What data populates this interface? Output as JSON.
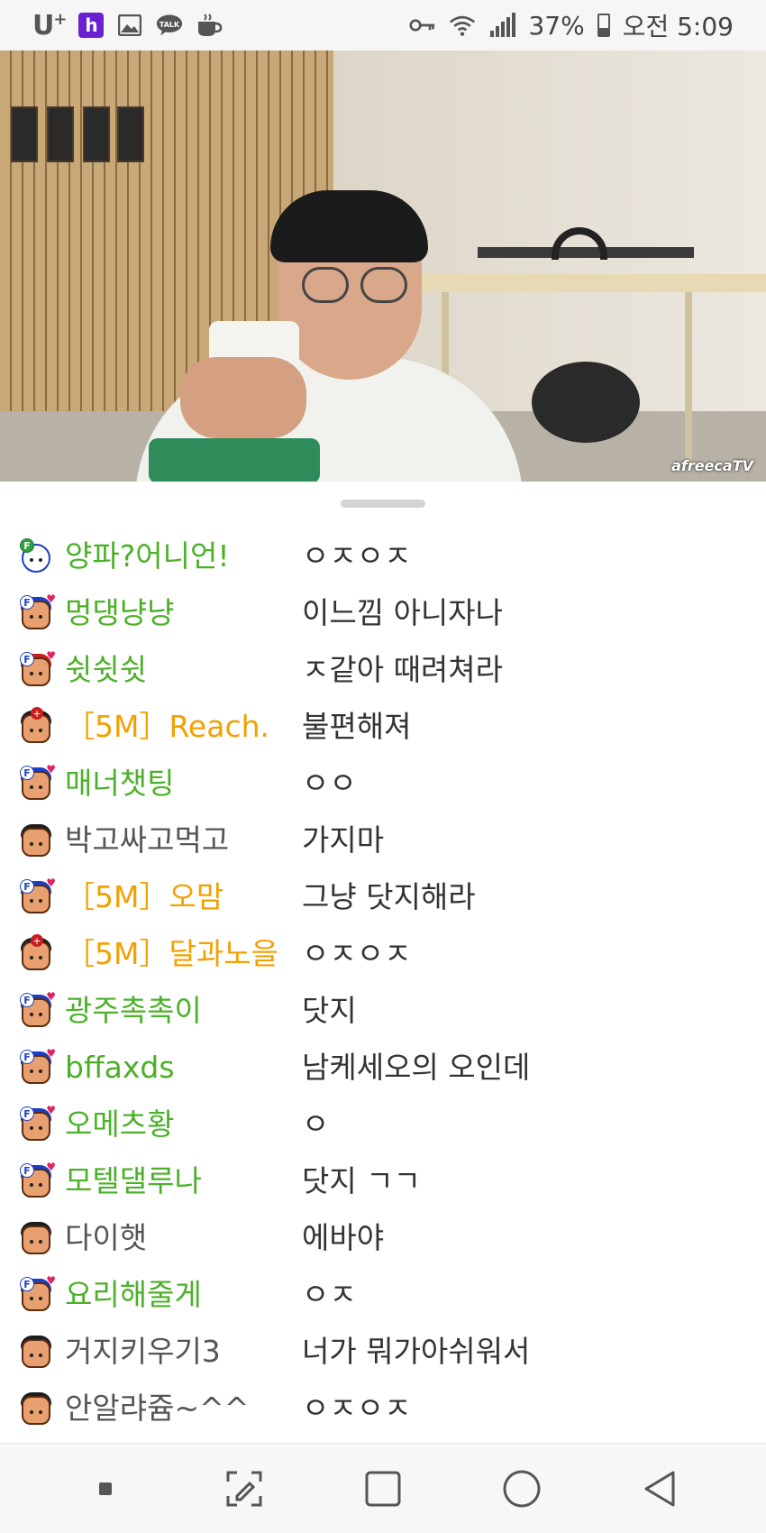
{
  "status_bar": {
    "carrier": "U",
    "carrier_sup": "+",
    "notif_h": "h",
    "talk_label": "TALK",
    "battery_text": "37%",
    "time": "오전 5:09",
    "battery_level": 0.37
  },
  "video": {
    "watermark": "afreecaTV"
  },
  "chat": [
    {
      "nick": "양파?어니언!",
      "msg": "ㅇㅈㅇㅈ",
      "nick_type": "fan",
      "avatar": "panda"
    },
    {
      "nick": "멍댕냥냥",
      "msg": "이느낌 아니자나",
      "nick_type": "fan",
      "avatar": "fan"
    },
    {
      "nick": "쉿쉿쉿",
      "msg": "ㅈ같아 때려쳐라",
      "nick_type": "fan",
      "avatar": "fan-red"
    },
    {
      "nick": "［5M］Reach.",
      "msg": "불편해져",
      "nick_type": "vip",
      "avatar": "vip"
    },
    {
      "nick": "매너챗팅",
      "msg": "ㅇㅇ",
      "nick_type": "fan",
      "avatar": "fan"
    },
    {
      "nick": "박고싸고먹고",
      "msg": "가지마",
      "nick_type": "normal",
      "avatar": "plain"
    },
    {
      "nick": "［5M］오맘",
      "msg": "그냥 닷지해라",
      "nick_type": "vip",
      "avatar": "fan"
    },
    {
      "nick": "［5M］달과노을",
      "msg": "ㅇㅈㅇㅈ",
      "nick_type": "vip",
      "avatar": "vip"
    },
    {
      "nick": "광주촉촉이",
      "msg": "닷지",
      "nick_type": "fan",
      "avatar": "fan"
    },
    {
      "nick": "bffaxds",
      "msg": "남케세오의 오인데",
      "nick_type": "fan",
      "avatar": "fan"
    },
    {
      "nick": "오메츠황",
      "msg": "ㅇ",
      "nick_type": "fan",
      "avatar": "fan"
    },
    {
      "nick": "모텔댈루나",
      "msg": "닷지 ㄱㄱ",
      "nick_type": "fan",
      "avatar": "fan"
    },
    {
      "nick": "다이햇",
      "msg": "에바야",
      "nick_type": "normal",
      "avatar": "plain"
    },
    {
      "nick": "요리해줄게",
      "msg": "ㅇㅈ",
      "nick_type": "fan",
      "avatar": "fan"
    },
    {
      "nick": "거지키우기3",
      "msg": "너가 뭐가아쉬워서",
      "nick_type": "normal",
      "avatar": "plain"
    },
    {
      "nick": "안알랴쥼~^^",
      "msg": "ㅇㅈㅇㅈ",
      "nick_type": "normal",
      "avatar": "plain"
    }
  ],
  "colors": {
    "fan_nick": "#4bb128",
    "vip_nick": "#f2a100",
    "normal_nick": "#555555"
  },
  "nav_bar": {
    "icons": [
      "recent-dot-icon",
      "capture-icon",
      "overview-square-icon",
      "home-circle-icon",
      "back-triangle-icon"
    ]
  }
}
